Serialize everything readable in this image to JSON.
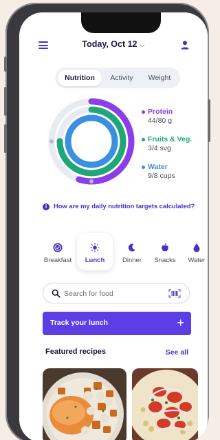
{
  "header": {
    "title": "Today, Oct 12",
    "chevron": "⌵"
  },
  "tabs": [
    {
      "label": "Nutrition",
      "active": true
    },
    {
      "label": "Activity",
      "active": false
    },
    {
      "label": "Weight",
      "active": false
    }
  ],
  "nutrition": {
    "rings": [
      {
        "name": "Protein",
        "value_text": "44/80 g",
        "fraction": 0.55,
        "color": "#8a3fe8"
      },
      {
        "name": "Fruits & Veg.",
        "value_text": "3/4 svg",
        "fraction": 0.75,
        "color": "#1fa77a"
      },
      {
        "name": "Water",
        "value_text": "9/8 cups",
        "fraction": 1.0,
        "color": "#3a8fe0"
      }
    ]
  },
  "info_link": "How are my daily nutrition targets calculated?",
  "meals": [
    {
      "label": "Breakfast",
      "icon": "check-circle-icon",
      "active": false
    },
    {
      "label": "Lunch",
      "icon": "sun-icon",
      "active": true
    },
    {
      "label": "Dinner",
      "icon": "moon-icon",
      "active": false
    },
    {
      "label": "Snacks",
      "icon": "apple-icon",
      "active": false
    },
    {
      "label": "Water",
      "icon": "water-drop-icon",
      "active": false
    }
  ],
  "search": {
    "placeholder": "Search for food"
  },
  "track_button": {
    "label": "Track your lunch",
    "plus": "+"
  },
  "featured": {
    "title": "Featured recipes",
    "see_all": "See all"
  },
  "colors": {
    "accent": "#4b2fc8",
    "button": "#5b3ee6",
    "protein": "#8a3fe8",
    "fruits": "#1fa77a",
    "water": "#3a8fe0"
  }
}
